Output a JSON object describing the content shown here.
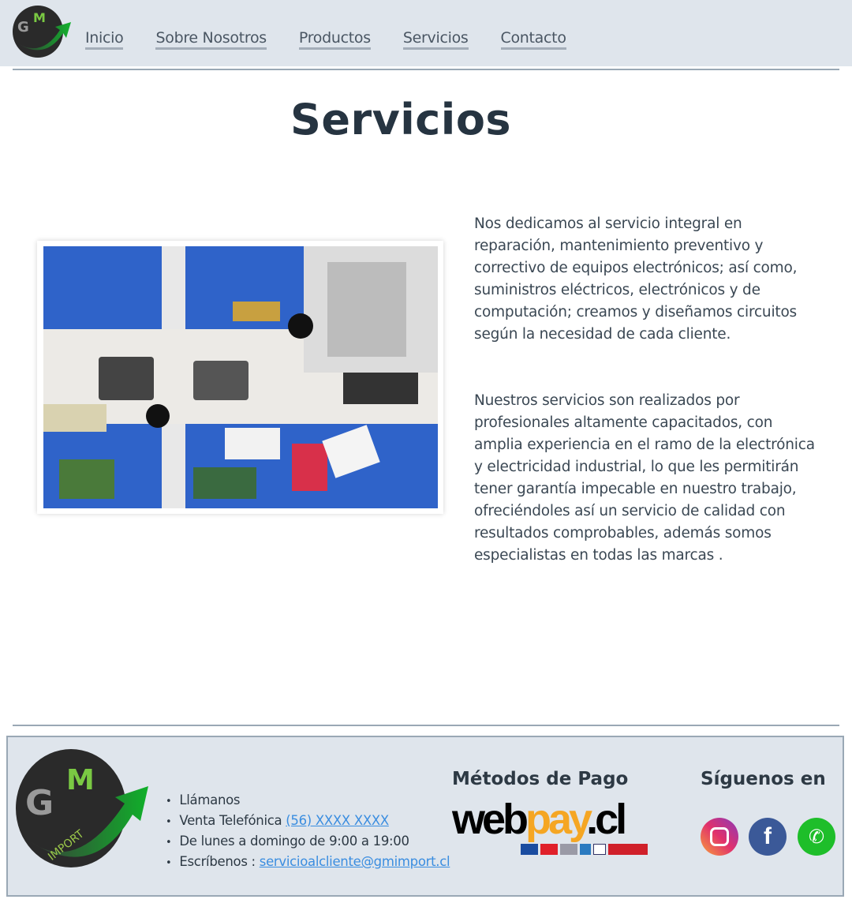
{
  "nav": {
    "items": [
      "Inicio",
      "Sobre Nosotros",
      "Productos",
      "Servicios",
      "Contacto"
    ]
  },
  "main": {
    "title": "Servicios",
    "paragraphs": [
      "Nos dedicamos al servicio integral en reparación, mantenimiento preventivo y correctivo de equipos electrónicos; así como, suministros eléctricos, electrónicos y de computación; creamos y diseñamos circuitos según la necesidad de cada cliente.",
      "Nuestros servicios son realizados por profesionales altamente capacitados, con amplia experiencia en el ramo de la electrónica y electricidad industrial, lo que les permitirán tener garantía impecable en nuestro trabajo, ofreciéndoles así un servicio de calidad con resultados comprobables, además somos especialistas en todas las marcas ."
    ]
  },
  "logo": {
    "text": "GM",
    "sub": "IMPORT"
  },
  "footer": {
    "call": "Llámanos",
    "phone_label": "Venta Telefónica",
    "phone": "(56) XXXX XXXX",
    "hours": "De lunes a domingo de 9:00 a 19:00",
    "email_label": "Escríbenos :",
    "email": "servicioalcliente@gmimport.cl",
    "payment_title": "Métodos de Pago",
    "webpay_a": "web",
    "webpay_b": "pay",
    "webpay_c": ".cl",
    "social_title": "Síguenos en",
    "social": [
      "instagram",
      "facebook",
      "whatsapp"
    ]
  },
  "colors": {
    "nav_bg": "#dfe5ec",
    "title": "#263441",
    "link": "#3a8de0",
    "green": "#1aa82e"
  }
}
